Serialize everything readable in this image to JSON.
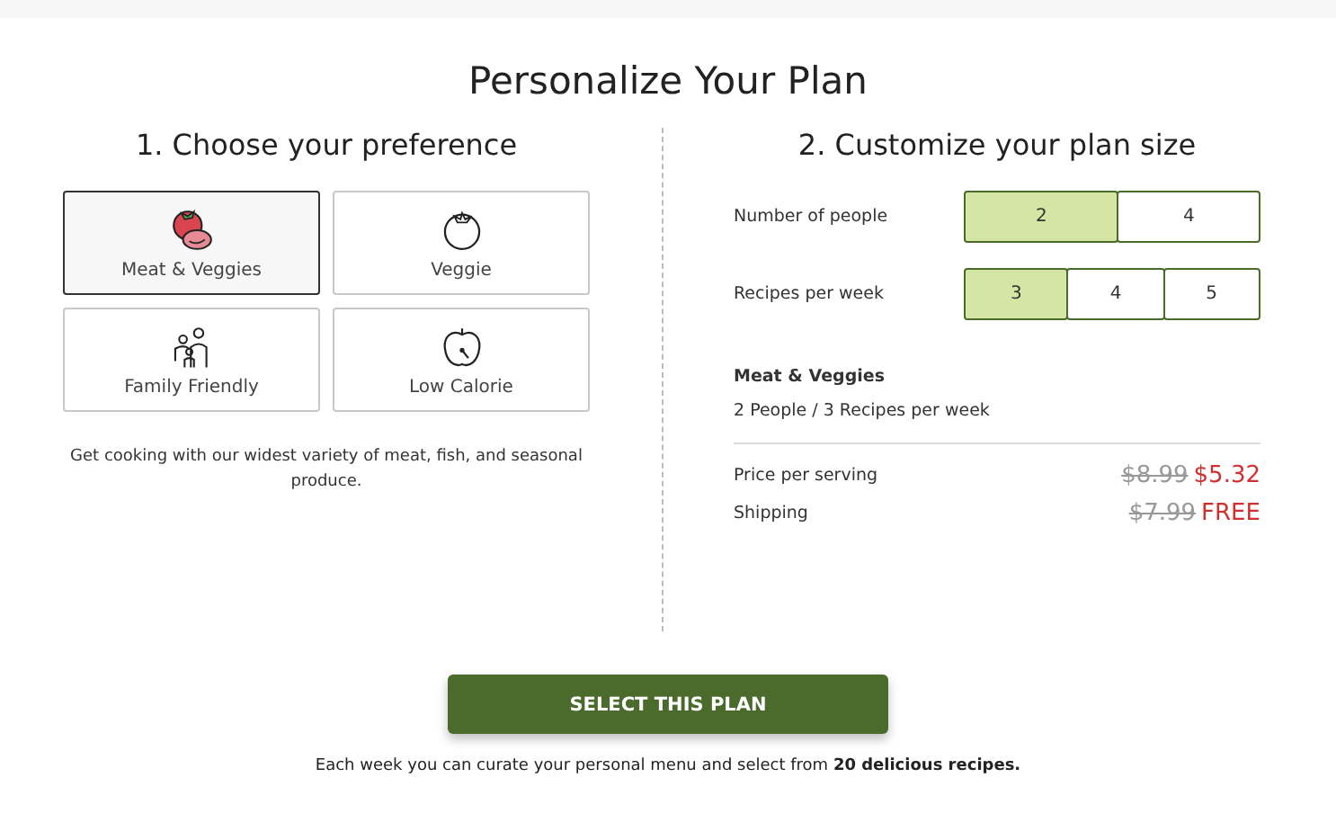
{
  "title": "Personalize Your Plan",
  "preference": {
    "heading": "1. Choose your preference",
    "options": [
      {
        "label": "Meat & Veggies",
        "selected": true
      },
      {
        "label": "Veggie",
        "selected": false
      },
      {
        "label": "Family Friendly",
        "selected": false
      },
      {
        "label": "Low Calorie",
        "selected": false
      }
    ],
    "description": "Get cooking with our widest variety of meat, fish, and seasonal produce."
  },
  "size": {
    "heading": "2. Customize your plan size",
    "selectors": [
      {
        "label": "Number of people",
        "options": [
          {
            "label": "2",
            "selected": true
          },
          {
            "label": "4",
            "selected": false
          }
        ]
      },
      {
        "label": "Recipes per week",
        "options": [
          {
            "label": "3",
            "selected": true
          },
          {
            "label": "4",
            "selected": false
          },
          {
            "label": "5",
            "selected": false
          }
        ]
      }
    ],
    "summary_title": "Meat & Veggies",
    "summary_detail": "2 People / 3 Recipes per week",
    "prices": [
      {
        "label": "Price per serving",
        "old": "$8.99",
        "new": "$5.32"
      },
      {
        "label": "Shipping",
        "old": "$7.99",
        "new": "FREE"
      }
    ]
  },
  "button": "SELECT THIS PLAN",
  "footnote": "Each week you can curate your personal menu and select from **20 delicious recipes.**"
}
